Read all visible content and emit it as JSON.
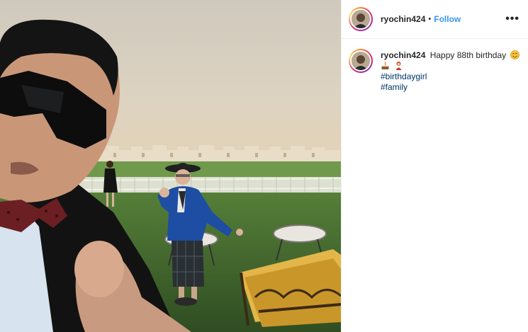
{
  "post": {
    "image_alt": "Selfie of a man in sunglasses and bow tie pointing at the camera with an older woman in a blue jacket waving on a lawn",
    "username": "ryochin424",
    "separator": "•",
    "follow_label": "Follow",
    "more_label": "•••"
  },
  "caption": {
    "username": "ryochin424",
    "text": "Happy 88th birthday",
    "emojis": [
      "smiling-face-emoji",
      "cake-emoji",
      "woman-emoji"
    ],
    "hashtags": [
      "#birthdaygirl",
      "#family"
    ]
  },
  "colors": {
    "link": "#3897f0",
    "hashtag": "#003569",
    "text": "#262626",
    "divider": "#efefef"
  }
}
